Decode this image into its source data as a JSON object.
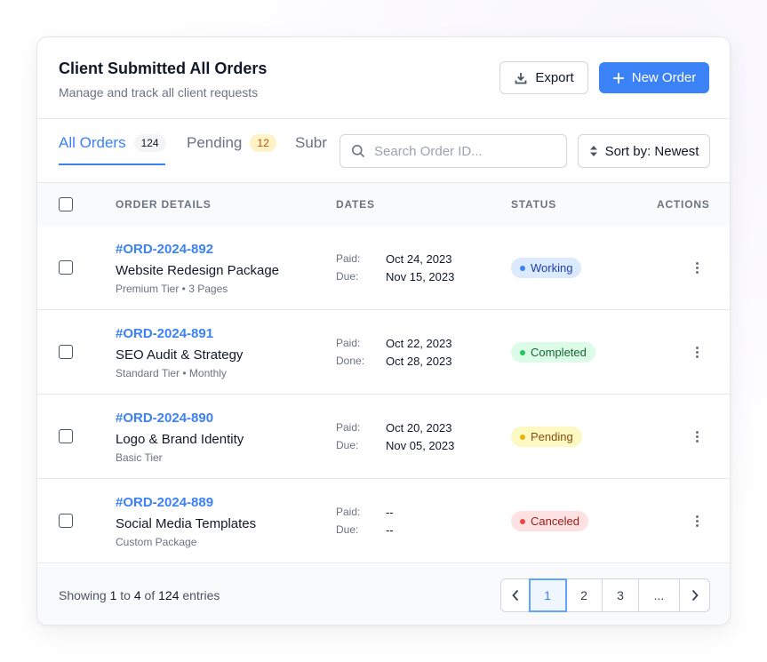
{
  "header": {
    "title": "Client Submitted All Orders",
    "subtitle": "Manage and track all client requests",
    "export_label": "Export",
    "new_order_label": "New Order",
    "accent_color": "#3b82f6"
  },
  "tabs": [
    {
      "label": "All Orders",
      "count": "124",
      "active": true
    },
    {
      "label": "Pending",
      "count": "12",
      "active": false
    },
    {
      "label": "Subr",
      "count": "",
      "active": false
    }
  ],
  "search": {
    "placeholder": "Search Order ID...",
    "value": ""
  },
  "sort": {
    "label": "Sort by: Newest"
  },
  "table": {
    "columns": [
      "ORDER DETAILS",
      "DATES",
      "STATUS",
      "ACTIONS"
    ],
    "rows": [
      {
        "id": "#ORD-2024-892",
        "name": "Website Redesign Package",
        "meta": "Premium Tier • 3 Pages",
        "date1_label": "Paid:",
        "date1_value": "Oct 24, 2023",
        "date2_label": "Due:",
        "date2_value": "Nov 15, 2023",
        "status": "Working",
        "status_color": "#3b82f6"
      },
      {
        "id": "#ORD-2024-891",
        "name": "SEO Audit & Strategy",
        "meta": "Standard Tier • Monthly",
        "date1_label": "Paid:",
        "date1_value": "Oct 22, 2023",
        "date2_label": "Done:",
        "date2_value": "Oct 28, 2023",
        "status": "Completed",
        "status_color": "#22c55e"
      },
      {
        "id": "#ORD-2024-890",
        "name": "Logo & Brand Identity",
        "meta": "Basic Tier",
        "date1_label": "Paid:",
        "date1_value": "Oct 20, 2023",
        "date2_label": "Due:",
        "date2_value": "Nov 05, 2023",
        "status": "Pending",
        "status_color": "#eab308"
      },
      {
        "id": "#ORD-2024-889",
        "name": "Social Media Templates",
        "meta": "Custom Package",
        "date1_label": "Paid:",
        "date1_value": "--",
        "date2_label": "Due:",
        "date2_value": "--",
        "status": "Canceled",
        "status_color": "#ef4444"
      }
    ]
  },
  "footer": {
    "showing_prefix": "Showing",
    "from": "1",
    "to_word": "to",
    "to": "4",
    "of_word": "of",
    "total": "124",
    "suffix": "entries",
    "pages": [
      "1",
      "2",
      "3",
      "..."
    ],
    "current_page": "1"
  },
  "icons": {
    "export": "download-icon",
    "new_order": "plus-icon",
    "search": "search-icon",
    "sort": "sort-icon",
    "prev": "chevron-left-icon",
    "next": "chevron-right-icon",
    "actions": "more-vertical-icon"
  }
}
